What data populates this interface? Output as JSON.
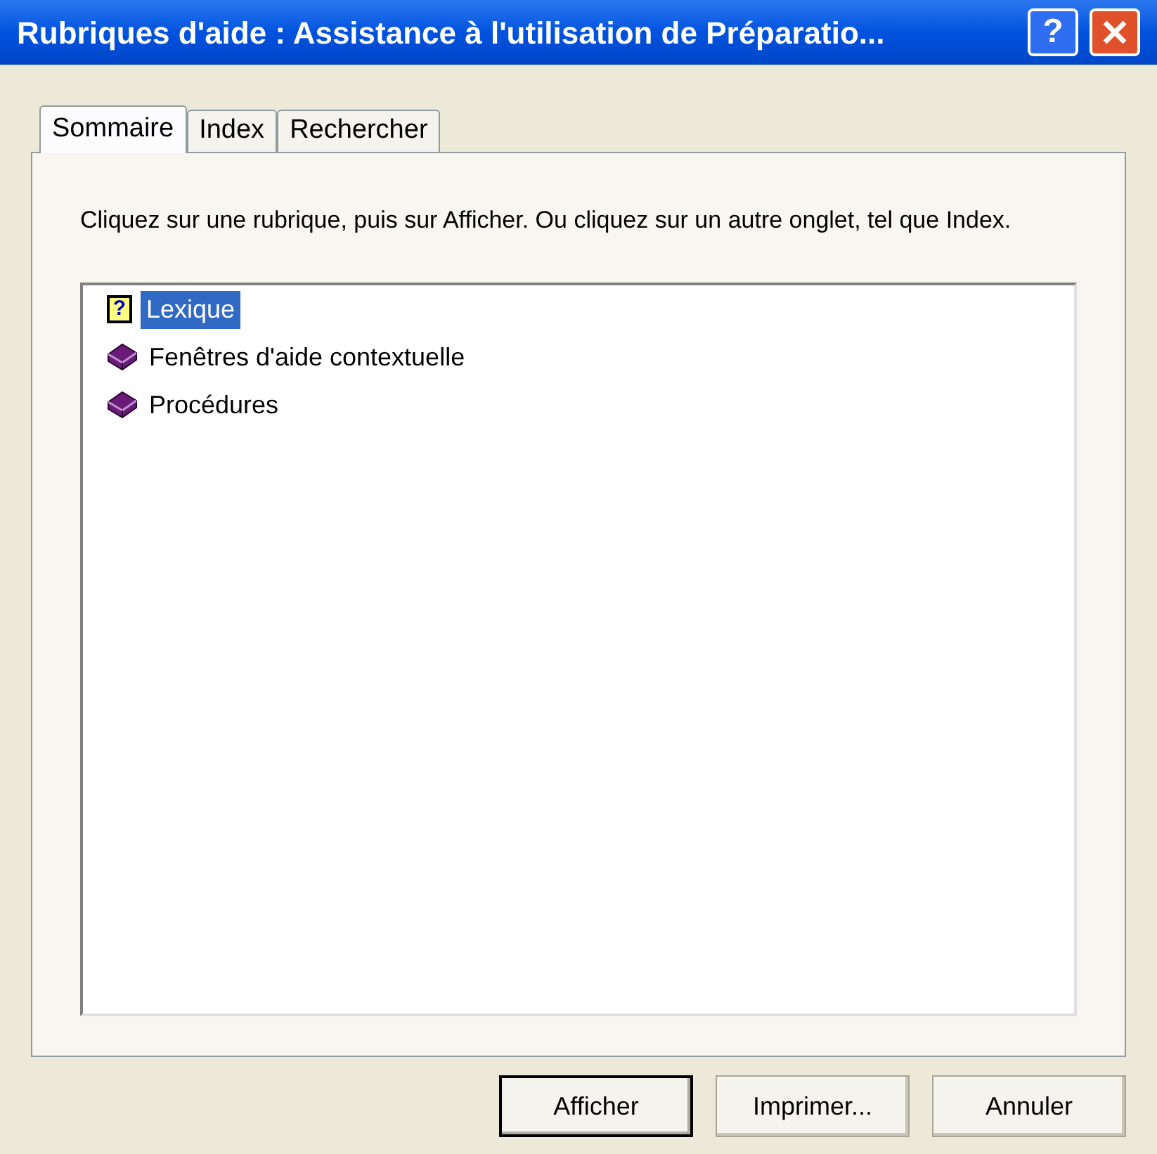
{
  "window": {
    "title": "Rubriques d'aide : Assistance à l'utilisation de Préparatio...",
    "help_button": "?"
  },
  "tabs": [
    {
      "label": "Sommaire",
      "selected": true
    },
    {
      "label": "Index",
      "selected": false
    },
    {
      "label": "Rechercher",
      "selected": false
    }
  ],
  "instructions": "Cliquez sur une rubrique, puis sur Afficher. Ou cliquez sur un autre onglet, tel que Index.",
  "tree": [
    {
      "kind": "topic",
      "icon_text": "?",
      "label": "Lexique",
      "selected": true
    },
    {
      "kind": "book",
      "label": "Fenêtres d'aide contextuelle",
      "selected": false
    },
    {
      "kind": "book",
      "label": "Procédures",
      "selected": false
    }
  ],
  "buttons": [
    {
      "label": "Afficher",
      "default": true
    },
    {
      "label": "Imprimer...",
      "default": false
    },
    {
      "label": "Annuler",
      "default": false
    }
  ]
}
